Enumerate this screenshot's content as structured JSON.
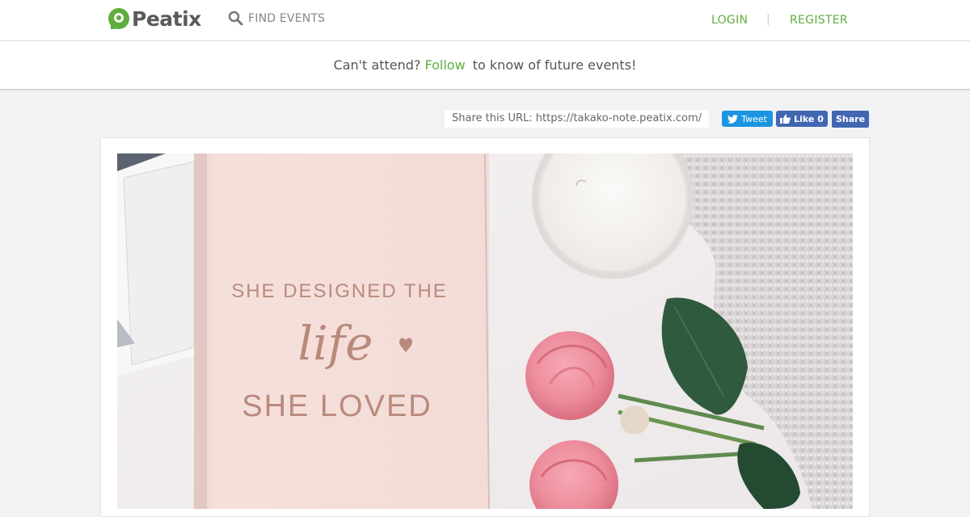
{
  "header": {
    "logo_text": "Peatix",
    "find_events_label": "FIND EVENTS",
    "login_label": "LOGIN",
    "separator": "|",
    "register_label": "REGISTER"
  },
  "banner": {
    "prefix": "Can't attend?",
    "follow_label": "Follow",
    "suffix": "to know of future events!"
  },
  "share": {
    "url_text": "Share this URL: https://takako-note.peatix.com/",
    "tweet_label": "Tweet",
    "like_label": "Like 0",
    "share_label": "Share"
  },
  "hero": {
    "book_line1": "SHE DESIGNED THE",
    "book_line2": "life",
    "book_line3": "SHE LOVED"
  },
  "colors": {
    "accent": "#5fad3c",
    "twitter": "#1b95e0",
    "facebook": "#4267b2"
  }
}
